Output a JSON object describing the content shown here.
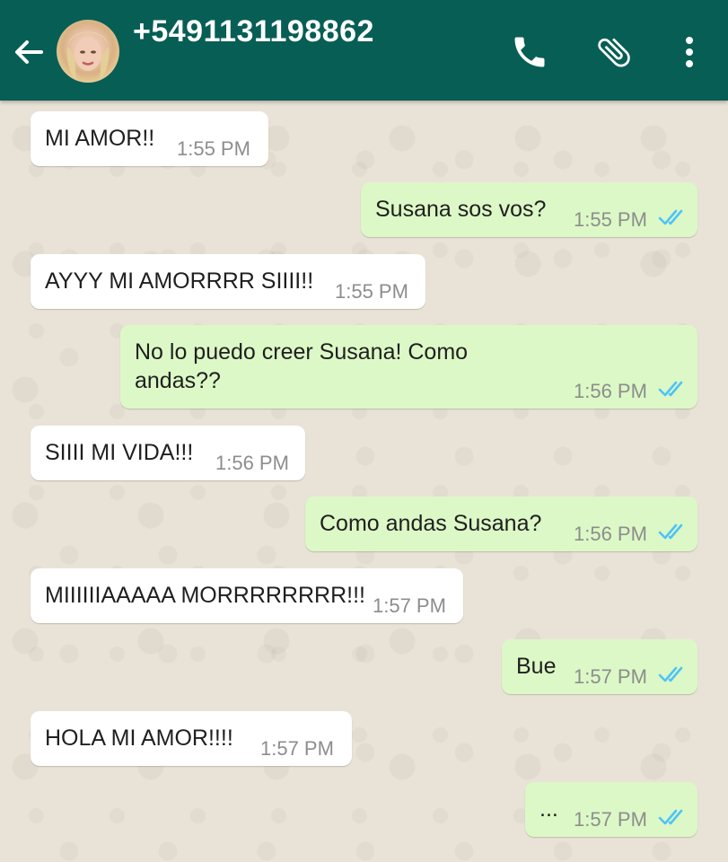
{
  "header": {
    "back_icon": "arrow-left-icon",
    "title": "+5491131198862",
    "call_icon": "phone-icon",
    "attach_icon": "paperclip-icon",
    "menu_icon": "more-vertical-icon",
    "color": "#075e54"
  },
  "colors": {
    "incoming_bubble": "#ffffff",
    "outgoing_bubble": "#dcf8c6",
    "read_ticks": "#4fc3f7",
    "timestamp": "#8d8d8d"
  },
  "messages": [
    {
      "direction": "in",
      "text": "MI AMOR!!",
      "time": "1:55 PM"
    },
    {
      "direction": "out",
      "text": "Susana sos vos?",
      "time": "1:55 PM",
      "status": "read"
    },
    {
      "direction": "in",
      "text": "AYYY MI AMORRRR SIIII!!",
      "time": "1:55 PM"
    },
    {
      "direction": "out",
      "text": "No lo puedo creer Susana! Como andas??",
      "time": "1:56 PM",
      "status": "read"
    },
    {
      "direction": "in",
      "text": "SIIII MI VIDA!!!",
      "time": "1:56 PM"
    },
    {
      "direction": "out",
      "text": "Como andas Susana?",
      "time": "1:56 PM",
      "status": "read"
    },
    {
      "direction": "in",
      "text": "MIIIIIIAAAAA MORRRRRRRR!!!",
      "time": "1:57 PM"
    },
    {
      "direction": "out",
      "text": "Bue",
      "time": "1:57 PM",
      "status": "read"
    },
    {
      "direction": "in",
      "text": "HOLA MI AMOR!!!!",
      "time": "1:57 PM"
    },
    {
      "direction": "out",
      "text": "...",
      "time": "1:57 PM",
      "status": "read"
    }
  ]
}
